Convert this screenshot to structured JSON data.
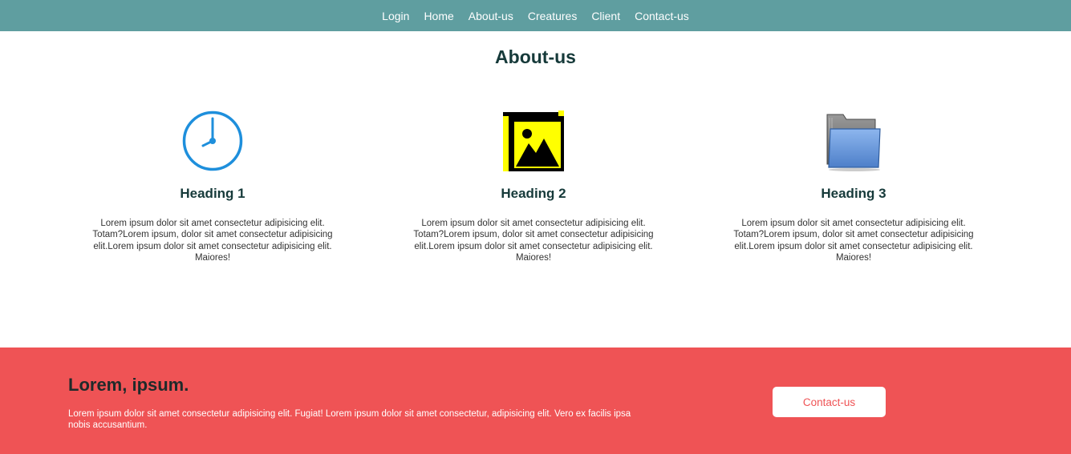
{
  "nav": {
    "items": [
      {
        "label": "Login"
      },
      {
        "label": "Home"
      },
      {
        "label": "About-us"
      },
      {
        "label": "Creatures"
      },
      {
        "label": "Client"
      },
      {
        "label": "Contact-us"
      }
    ]
  },
  "about": {
    "title": "About-us",
    "features": [
      {
        "icon": "clock-icon",
        "heading": "Heading 1",
        "text": "Lorem ipsum dolor sit amet consectetur adipisicing elit. Totam?Lorem ipsum, dolor sit amet consectetur adipisicing elit.Lorem ipsum dolor sit amet consectetur adipisicing elit. Maiores!"
      },
      {
        "icon": "image-gallery-icon",
        "heading": "Heading 2",
        "text": "Lorem ipsum dolor sit amet consectetur adipisicing elit. Totam?Lorem ipsum, dolor sit amet consectetur adipisicing elit.Lorem ipsum dolor sit amet consectetur adipisicing elit. Maiores!"
      },
      {
        "icon": "folder-icon",
        "heading": "Heading 3",
        "text": "Lorem ipsum dolor sit amet consectetur adipisicing elit. Totam?Lorem ipsum, dolor sit amet consectetur adipisicing elit.Lorem ipsum dolor sit amet consectetur adipisicing elit. Maiores!"
      }
    ]
  },
  "footer": {
    "heading": "Lorem, ipsum.",
    "text": "Lorem ipsum dolor sit amet consectetur adipisicing elit. Fugiat! Lorem ipsum dolor sit amet consectetur, adipisicing elit. Vero ex facilis ipsa nobis accusantium.",
    "button_label": "Contact-us"
  },
  "colors": {
    "navbar": "#5f9ea0",
    "footer": "#ef5355",
    "heading": "#163a3a",
    "clock": "#1e8fdc",
    "gallery_yellow": "#ffff00",
    "folder_blue": "#5d8fd8"
  }
}
